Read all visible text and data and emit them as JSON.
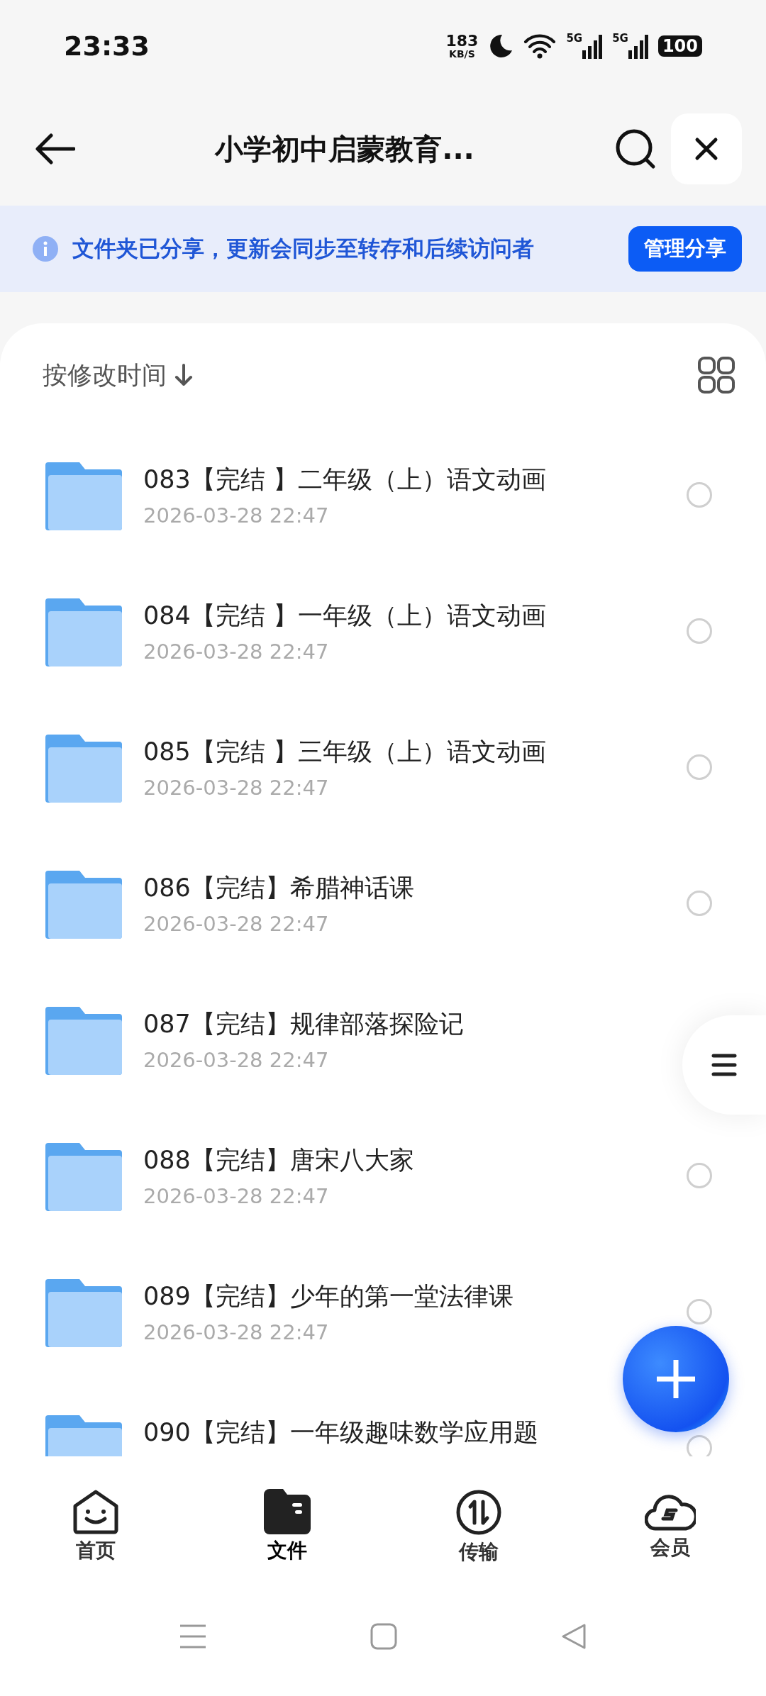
{
  "status_bar": {
    "time": "23:33",
    "speed_value": "183",
    "speed_unit": "KB/S",
    "signals": [
      "5G",
      "5G"
    ],
    "battery": "100"
  },
  "header": {
    "title": "小学初中启蒙教育..."
  },
  "banner": {
    "text": "文件夹已分享，更新会同步至转存和后续访问者",
    "button": "管理分享"
  },
  "sort": {
    "label": "按修改时间",
    "descending": true
  },
  "files": [
    {
      "name": "083【完结 】二年级（上）语文动画",
      "date": "2026-03-28 22:47",
      "selected": false
    },
    {
      "name": "084【完结 】一年级（上）语文动画",
      "date": "2026-03-28 22:47",
      "selected": false
    },
    {
      "name": "085【完结 】三年级（上）语文动画",
      "date": "2026-03-28 22:47",
      "selected": false
    },
    {
      "name": "086【完结】希腊神话课",
      "date": "2026-03-28 22:47",
      "selected": false
    },
    {
      "name": "087【完结】规律部落探险记",
      "date": "2026-03-28 22:47"
    },
    {
      "name": "088【完结】唐宋八大家",
      "date": "2026-03-28 22:47",
      "selected": false
    },
    {
      "name": "089【完结】少年的第一堂法律课",
      "date": "2026-03-28 22:47",
      "selected": false
    },
    {
      "name": "090【完结】一年级趣味数学应用题",
      "selected": false
    }
  ],
  "tabs": [
    {
      "kind": "home",
      "label": "首页",
      "selected": false
    },
    {
      "kind": "files",
      "label": "文件",
      "selected": true
    },
    {
      "kind": "transfer",
      "label": "传输",
      "selected": false
    },
    {
      "kind": "vip",
      "label": "会员",
      "selected": false
    }
  ]
}
